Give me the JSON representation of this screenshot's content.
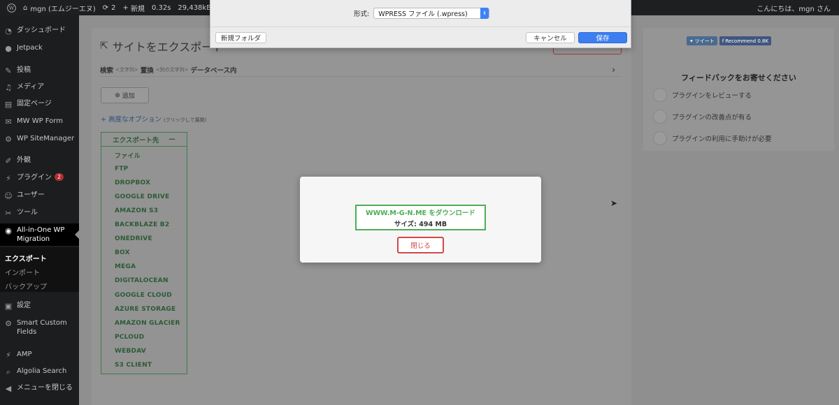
{
  "adminbar": {
    "site_name": "mgn (エムジーエヌ)",
    "updates_count": "2",
    "new_label": "新規",
    "query_time": "0.32s",
    "memory": "29,438kB",
    "greeting": "こんにちは、mgn さん"
  },
  "sidebar": {
    "items": [
      {
        "label": "ダッシュボード",
        "icon": "dashboard-icon"
      },
      {
        "label": "Jetpack",
        "icon": "jetpack-icon"
      },
      {
        "label": "投稿",
        "icon": "pin-icon"
      },
      {
        "label": "メディア",
        "icon": "media-icon"
      },
      {
        "label": "固定ページ",
        "icon": "page-icon"
      },
      {
        "label": "MW WP Form",
        "icon": "form-icon"
      },
      {
        "label": "WP SiteManager",
        "icon": "gear-icon"
      },
      {
        "label": "外観",
        "icon": "brush-icon"
      },
      {
        "label": "プラグイン",
        "icon": "plugin-icon",
        "badge": "2"
      },
      {
        "label": "ユーザー",
        "icon": "user-icon"
      },
      {
        "label": "ツール",
        "icon": "wrench-icon"
      },
      {
        "label": "All-in-One WP Migration",
        "icon": "migration-icon"
      },
      {
        "label": "設定",
        "icon": "settings-icon"
      },
      {
        "label": "Smart Custom Fields",
        "icon": "gear-icon"
      },
      {
        "label": "AMP",
        "icon": "amp-icon"
      },
      {
        "label": "Algolia Search",
        "icon": "search-icon"
      },
      {
        "label": "メニューを閉じる",
        "icon": "collapse-icon"
      }
    ],
    "submenu": [
      "エクスポート",
      "インポート",
      "バックアップ"
    ]
  },
  "page": {
    "title": "サイトをエクスポート",
    "sr_search": "検索",
    "sr_hint1": "<文字列>",
    "sr_replace": "置換",
    "sr_hint2": "<別の文字列>",
    "sr_db": "データベース内",
    "add_button": "追加",
    "advanced_options": "高度なオプション",
    "advanced_hint": "(クリックして展開)",
    "export_to": "エクスポート先",
    "export_targets": [
      "ファイル",
      "FTP",
      "DROPBOX",
      "GOOGLE DRIVE",
      "AMAZON S3",
      "BACKBLAZE B2",
      "ONEDRIVE",
      "BOX",
      "MEGA",
      "DIGITALOCEAN",
      "GOOGLE CLOUD",
      "AZURE STORAGE",
      "AMAZON GLACIER",
      "PCLOUD",
      "WEBDAV",
      "S3 CLIENT"
    ]
  },
  "feedback": {
    "tweet": "ツイート",
    "recommend": "Recommend 0.8K",
    "title": "フィードバックをお寄せください",
    "options": [
      "プラグインをレビューする",
      "プラグインの改善点が有る",
      "プラグインの利用に手助けが必要"
    ]
  },
  "save_dialog": {
    "format_label": "形式:",
    "format_value": "WPRESS ファイル (.wpress)",
    "new_folder": "新規フォルダ",
    "cancel": "キャンセル",
    "save": "保存"
  },
  "download_modal": {
    "link": "WWW.M-G-N.ME をダウンロード",
    "size": "サイズ: 494 MB",
    "close": "閉じる"
  }
}
